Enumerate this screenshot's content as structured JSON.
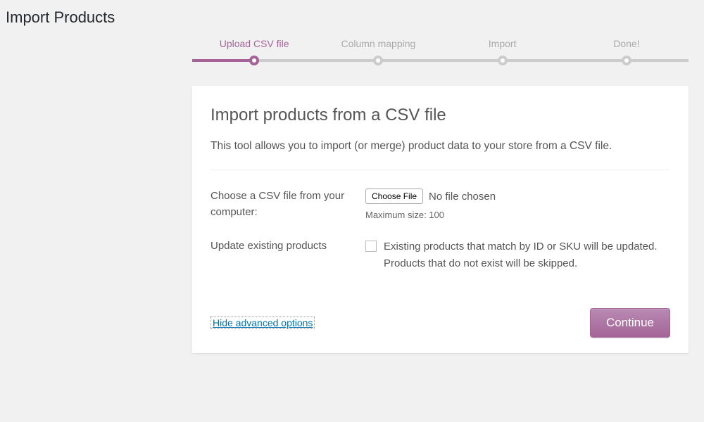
{
  "page_title": "Import Products",
  "steps": [
    {
      "label": "Upload CSV file",
      "active": true
    },
    {
      "label": "Column mapping",
      "active": false
    },
    {
      "label": "Import",
      "active": false
    },
    {
      "label": "Done!",
      "active": false
    }
  ],
  "card": {
    "title": "Import products from a CSV file",
    "description": "This tool allows you to import (or merge) product data to your store from a CSV file."
  },
  "file_row": {
    "label": "Choose a CSV file from your computer:",
    "button": "Choose File",
    "status": "No file chosen",
    "hint": "Maximum size: 100"
  },
  "update_row": {
    "label": "Update existing products",
    "text": "Existing products that match by ID or SKU will be updated. Products that do not exist will be skipped."
  },
  "footer": {
    "advanced_link": "Hide advanced options",
    "continue": "Continue"
  }
}
